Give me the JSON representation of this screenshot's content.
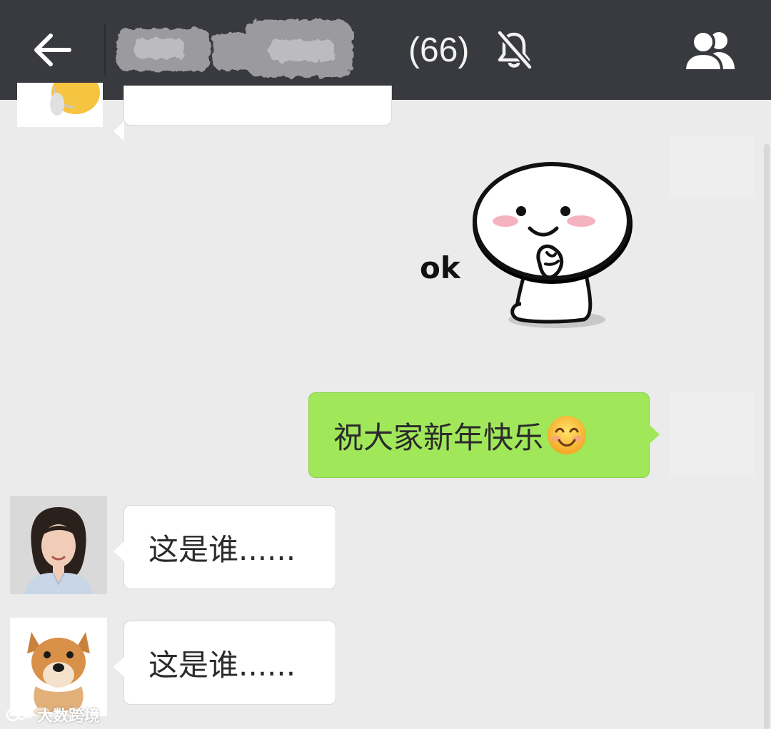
{
  "header": {
    "member_count": "(66)",
    "icons": {
      "back": "back-arrow-icon",
      "mute": "bell-muted-icon",
      "members": "group-members-icon"
    },
    "background_color": "#393a3f"
  },
  "messages": [
    {
      "side": "left",
      "type": "text",
      "text": "",
      "partially_visible": true
    },
    {
      "side": "right",
      "type": "sticker",
      "sticker_text": "ok"
    },
    {
      "side": "right",
      "type": "text",
      "text": "祝大家新年快乐",
      "emoji": "smiling-face-icon"
    },
    {
      "side": "left",
      "type": "text",
      "text": "这是谁......",
      "avatar": "woman-portrait"
    },
    {
      "side": "left",
      "type": "text",
      "text": "这是谁......",
      "avatar": "shiba-dog"
    }
  ],
  "colors": {
    "chat_background": "#ebebeb",
    "outgoing_bubble": "#a0e75a",
    "incoming_bubble": "#ffffff"
  },
  "watermark": {
    "text": "大数跨境"
  }
}
